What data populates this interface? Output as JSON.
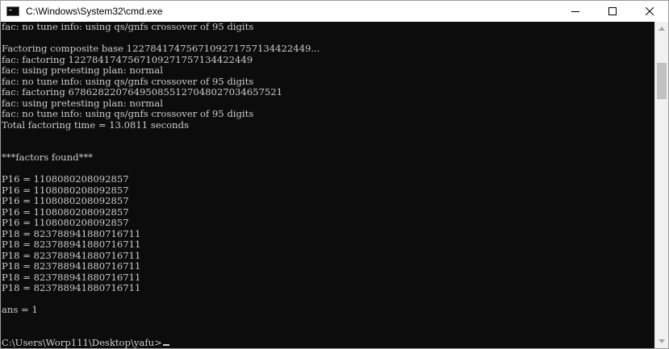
{
  "window": {
    "title": "C:\\Windows\\System32\\cmd.exe",
    "icon": "cmd-console-icon"
  },
  "controls": {
    "minimize_icon": "minimize-icon",
    "maximize_icon": "maximize-icon",
    "close_icon": "close-icon"
  },
  "console": {
    "lines": [
      "fac: no tune info: using qs/gnfs crossover of 95 digits",
      "",
      "Factoring composite base 122784174756710927175713442244­9...",
      "fac: factoring 1227841747567109271757134422449",
      "fac: using pretesting plan: normal",
      "fac: no tune info: using qs/gnfs crossover of 95 digits",
      "fac: factoring 678628220764950855127048027034657521",
      "fac: using pretesting plan: normal",
      "fac: no tune info: using qs/gnfs crossover of 95 digits",
      "Total factoring time = 13.0811 seconds",
      "",
      "",
      "***factors found***",
      "",
      "P16 = 1108080208092857",
      "P16 = 1108080208092857",
      "P16 = 1108080208092857",
      "P16 = 1108080208092857",
      "P16 = 1108080208092857",
      "P18 = 823788941880716711",
      "P18 = 823788941880716711",
      "P18 = 823788941880716711",
      "P18 = 823788941880716711",
      "P18 = 823788941880716711",
      "P18 = 823788941880716711",
      "",
      "ans = 1",
      "",
      "",
      "C:\\Users\\Worp111\\Desktop\\yafu>"
    ]
  }
}
